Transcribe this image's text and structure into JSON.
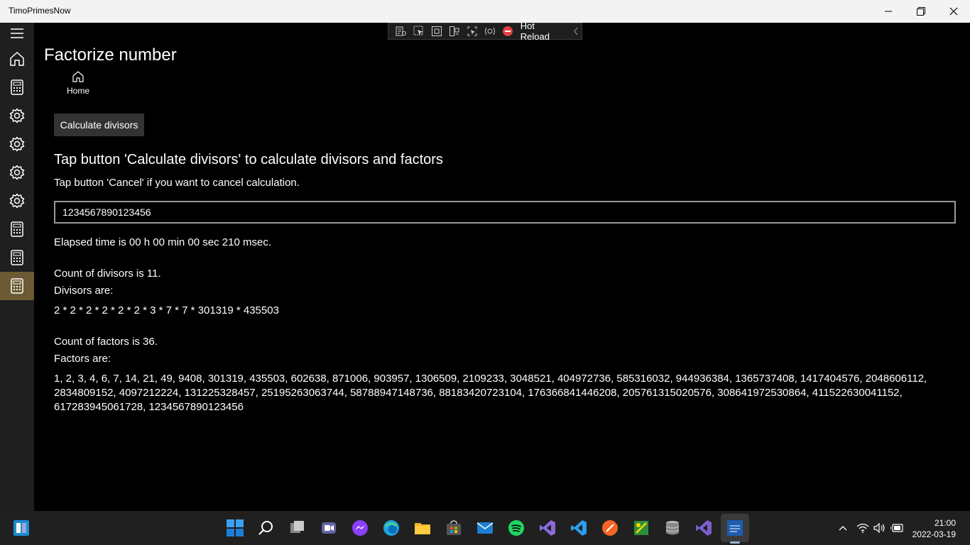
{
  "window": {
    "title": "TimoPrimesNow"
  },
  "hot_reload": {
    "label": "Hot Reload"
  },
  "page": {
    "title": "Factorize number",
    "home_label": "Home",
    "calculate_button": "Calculate divisors",
    "heading": "Tap button 'Calculate divisors' to calculate divisors and factors",
    "cancel_hint": "Tap button 'Cancel' if you want to cancel calculation.",
    "input_value": "1234567890123456",
    "elapsed": "Elapsed time is 00 h 00 min 00 sec 210 msec.",
    "divisor_count": "Count of divisors is 11.",
    "divisors_label": "Divisors are:",
    "divisors": "2 * 2 * 2 * 2 * 2 * 2 * 3 * 7 * 7 * 301319 * 435503",
    "factor_count": "Count of factors is 36.",
    "factors_label": "Factors are:",
    "factors": "1, 2, 3, 4, 6, 7, 14, 21, 49, 9408, 301319, 435503, 602638, 871006, 903957, 1306509, 2109233, 3048521, 404972736, 585316032, 944936384, 1365737408, 1417404576, 2048606112, 2834809152, 4097212224, 131225328457, 25195263063744, 58788947148736, 88183420723104, 176366841446208, 205761315020576, 308641972530864, 411522630041152, 617283945061728, 1234567890123456"
  },
  "sidebar": {
    "items": [
      {
        "icon": "hamburger-icon"
      },
      {
        "icon": "home-icon"
      },
      {
        "icon": "calculator-icon"
      },
      {
        "icon": "gear-icon"
      },
      {
        "icon": "gear-icon"
      },
      {
        "icon": "gear-icon"
      },
      {
        "icon": "gear-icon"
      },
      {
        "icon": "calculator-icon"
      },
      {
        "icon": "calculator-icon"
      },
      {
        "icon": "calculator-icon",
        "selected": true
      }
    ]
  },
  "taskbar": {
    "apps": [
      "widgets",
      "start",
      "search",
      "task-view",
      "teams",
      "messenger",
      "edge",
      "file-explorer",
      "store",
      "mail",
      "spotify",
      "visual-studio",
      "vs-code",
      "app-orange",
      "app-green",
      "database",
      "visual-studio-2",
      "timoprimesnow"
    ],
    "clock": {
      "time": "21:00",
      "date": "2022-03-19"
    }
  },
  "colors": {
    "selected_nav": "#6b5a33",
    "sidebar_bg": "#1f1f1f",
    "taskbar_bg": "#202020",
    "titlebar_bg": "#f3f3f3",
    "button_bg": "#333333"
  }
}
